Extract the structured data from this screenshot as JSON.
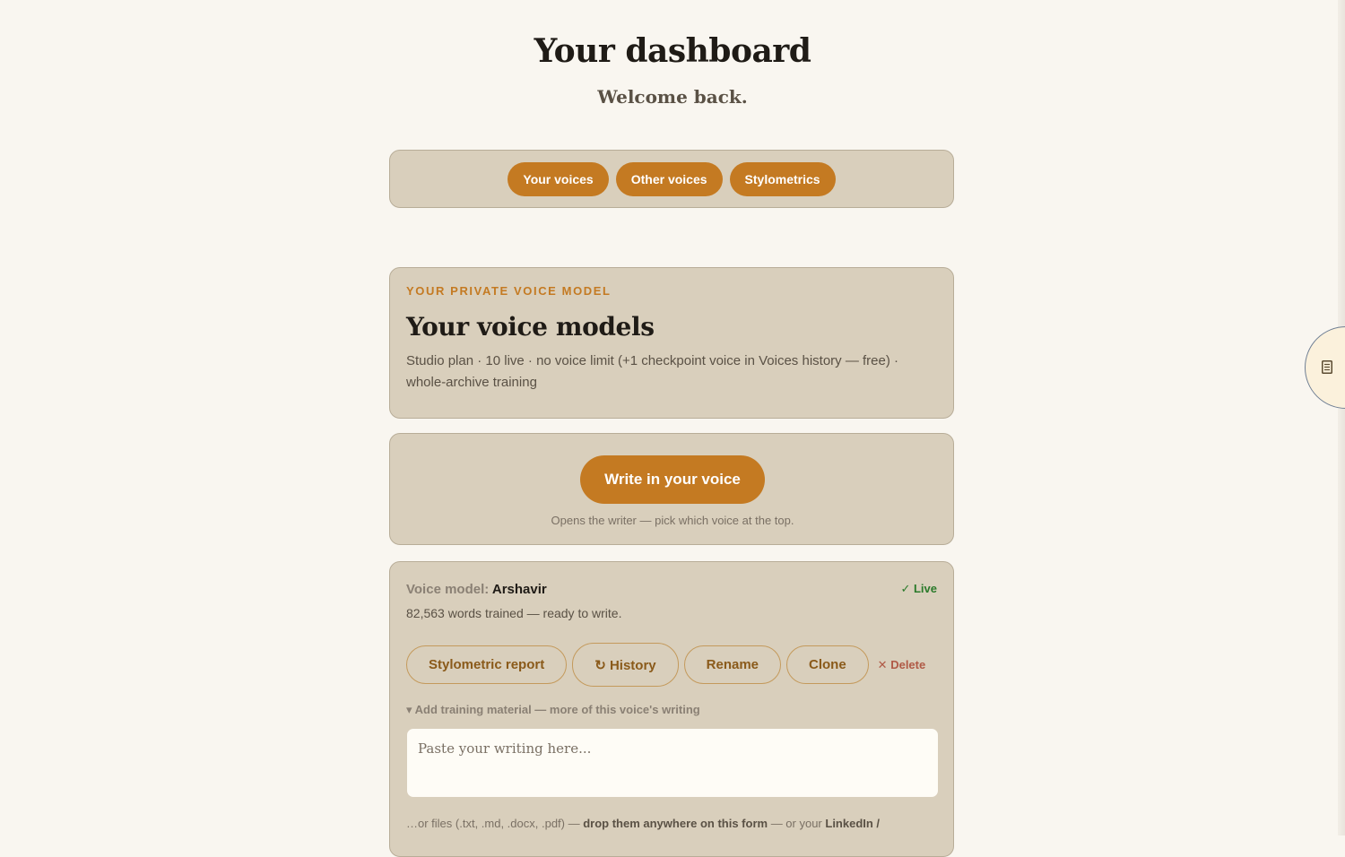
{
  "page": {
    "title": "Your dashboard",
    "subtitle": "Welcome back."
  },
  "nav": {
    "tabs": [
      {
        "label": "Your voices"
      },
      {
        "label": "Other voices"
      },
      {
        "label": "Stylometrics"
      }
    ]
  },
  "model_card": {
    "eyebrow": "YOUR PRIVATE VOICE MODEL",
    "heading": "Your voice models",
    "plan_text": "Studio plan · 10 live · no voice limit (+1 checkpoint voice in Voices history — free) · whole-archive training"
  },
  "write_card": {
    "button_label": "Write in your voice",
    "note": "Opens the writer — pick which voice at the top."
  },
  "voice": {
    "prefix": "Voice model:",
    "name": "Arshavir",
    "status_icon": "✓",
    "status": "Live",
    "words_text": "82,563 words trained — ready to write.",
    "actions": {
      "report": "Stylometric report",
      "history_icon": "↻",
      "history": "History",
      "rename": "Rename",
      "clone": "Clone",
      "delete_icon": "✕",
      "delete": "Delete"
    },
    "training": {
      "summary_icon": "▾",
      "summary": "Add training material — more of this voice's writing",
      "placeholder": "Paste your writing here...",
      "files_note_start": "…or files (.txt, .md, .docx, .pdf) — ",
      "files_note_bold": "drop them anywhere on this form",
      "files_note_mid": " — or your ",
      "files_note_end": "LinkedIn /"
    }
  },
  "side_tab": {
    "icon": "document-icon"
  },
  "colors": {
    "accent": "#c47a22",
    "panel": "#d9cfbc",
    "background": "#f9f6f0",
    "live": "#2a7a2a",
    "danger": "#b05a46"
  }
}
